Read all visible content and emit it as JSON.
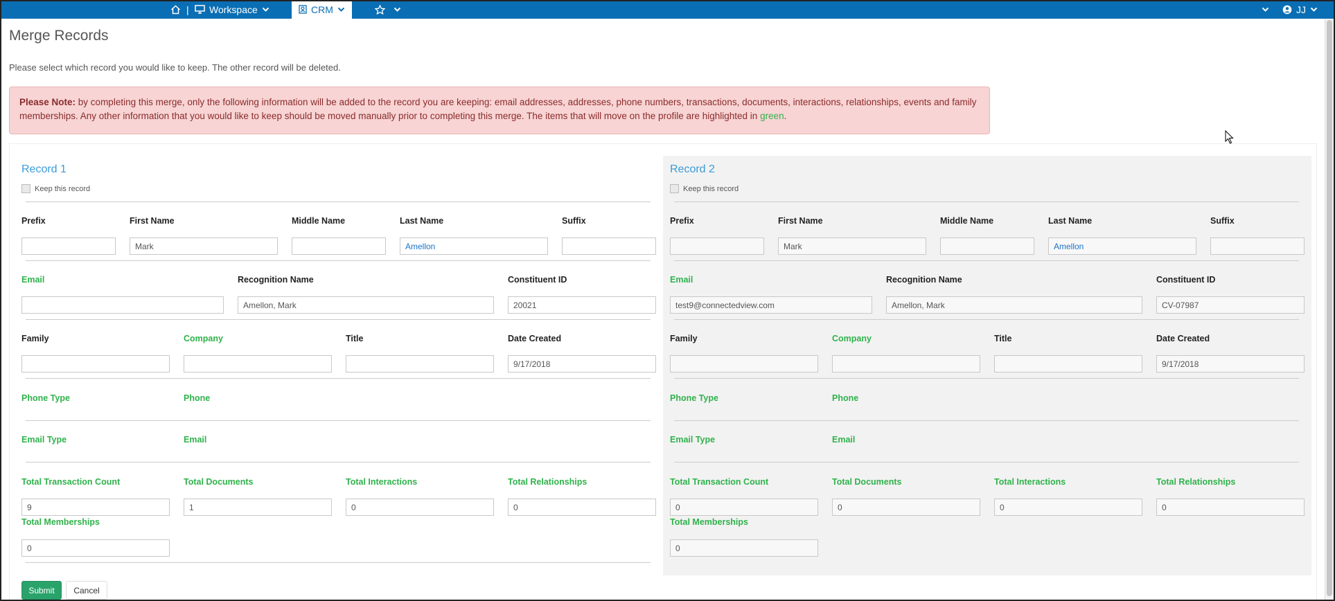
{
  "nav": {
    "workspace": "Workspace",
    "crm": "CRM",
    "user": "JJ",
    "separator": "|"
  },
  "page": {
    "title": "Merge Records",
    "intro": "Please select which record you would like to keep. The other record will be deleted."
  },
  "alert": {
    "lead": "Please Note:",
    "body": " by completing this merge, only the following information will be added to the record you are keeping: email addresses, addresses, phone numbers, transactions, documents, interactions, relationships, events and family memberships. Any other information that you would like to keep should be moved manually prior to completing this merge. The items that will move on the profile are highlighted in ",
    "green_word": "green",
    "end": "."
  },
  "labels": {
    "keep": "Keep this record",
    "prefix": "Prefix",
    "first_name": "First Name",
    "middle_name": "Middle Name",
    "last_name": "Last Name",
    "suffix": "Suffix",
    "email": "Email",
    "recognition_name": "Recognition Name",
    "constituent_id": "Constituent ID",
    "family": "Family",
    "company": "Company",
    "title": "Title",
    "date_created": "Date Created",
    "phone_type": "Phone Type",
    "phone": "Phone",
    "email_type": "Email Type",
    "email2": "Email",
    "total_transaction_count": "Total Transaction Count",
    "total_documents": "Total Documents",
    "total_interactions": "Total Interactions",
    "total_relationships": "Total Relationships",
    "total_memberships": "Total Memberships"
  },
  "record1": {
    "heading": "Record 1",
    "prefix": "",
    "first_name": "Mark",
    "middle_name": "",
    "last_name": "Amellon",
    "suffix": "",
    "email": "",
    "recognition_name": "Amellon, Mark",
    "constituent_id": "20021",
    "family": "",
    "company": "",
    "title": "",
    "date_created": "9/17/2018",
    "total_transaction_count": "9",
    "total_documents": "1",
    "total_interactions": "0",
    "total_relationships": "0",
    "total_memberships": "0"
  },
  "record2": {
    "heading": "Record 2",
    "prefix": "",
    "first_name": "Mark",
    "middle_name": "",
    "last_name": "Amellon",
    "suffix": "",
    "email": "test9@connectedview.com",
    "recognition_name": "Amellon, Mark",
    "constituent_id": "CV-07987",
    "family": "",
    "company": "",
    "title": "",
    "date_created": "9/17/2018",
    "total_transaction_count": "0",
    "total_documents": "0",
    "total_interactions": "0",
    "total_relationships": "0",
    "total_memberships": "0"
  },
  "buttons": {
    "submit": "Submit",
    "cancel": "Cancel"
  },
  "colors": {
    "nav_bar": "#0a6eb4",
    "green": "#2fb24b",
    "link_blue": "#3a9bd9",
    "alert_bg": "#f8d4d4"
  },
  "icons": [
    "home-icon",
    "monitor-icon",
    "contact-card-icon",
    "star-icon",
    "user-circle-icon",
    "chevron-down-icon"
  ]
}
